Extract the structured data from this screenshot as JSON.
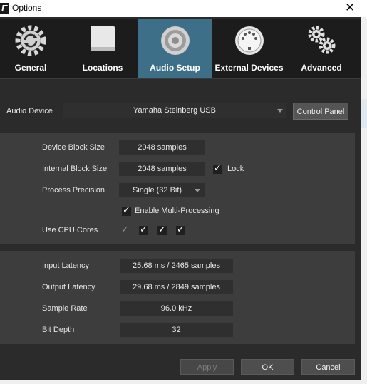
{
  "window": {
    "title": "Options",
    "close_glyph": "✕"
  },
  "tabs": [
    {
      "label": "General",
      "icon": "gear-refresh-icon",
      "active": false
    },
    {
      "label": "Locations",
      "icon": "hard-drive-icon",
      "active": false
    },
    {
      "label": "Audio Setup",
      "icon": "speaker-icon",
      "active": true
    },
    {
      "label": "External Devices",
      "icon": "midi-plug-icon",
      "active": false
    },
    {
      "label": "Advanced",
      "icon": "gears-icon",
      "active": false
    }
  ],
  "audio_device": {
    "label": "Audio Device",
    "value": "Yamaha Steinberg USB",
    "control_panel": "Control Panel"
  },
  "settings": {
    "device_block_size": {
      "label": "Device Block Size",
      "value": "2048 samples"
    },
    "internal_block_size": {
      "label": "Internal Block Size",
      "value": "2048 samples"
    },
    "lock": {
      "label": "Lock",
      "checked": true
    },
    "process_precision": {
      "label": "Process Precision",
      "value": "Single (32 Bit)"
    },
    "multi_processing": {
      "label": "Enable Multi-Processing",
      "checked": true
    },
    "cpu_cores": {
      "label": "Use CPU Cores",
      "cores": [
        true,
        true,
        true,
        true
      ],
      "first_disabled": true
    }
  },
  "info": {
    "input_latency": {
      "label": "Input Latency",
      "value": "25.68 ms / 2465 samples"
    },
    "output_latency": {
      "label": "Output Latency",
      "value": "29.68 ms / 2849 samples"
    },
    "sample_rate": {
      "label": "Sample Rate",
      "value": "96.0 kHz"
    },
    "bit_depth": {
      "label": "Bit Depth",
      "value": "32"
    }
  },
  "footer": {
    "apply": "Apply",
    "ok": "OK",
    "cancel": "Cancel"
  },
  "check_glyph": "✓",
  "colors": {
    "accent": "#3e6f89",
    "panel": "#3d3d3d",
    "background": "#2b2b2b",
    "toolbar": "#1c1c1c"
  }
}
